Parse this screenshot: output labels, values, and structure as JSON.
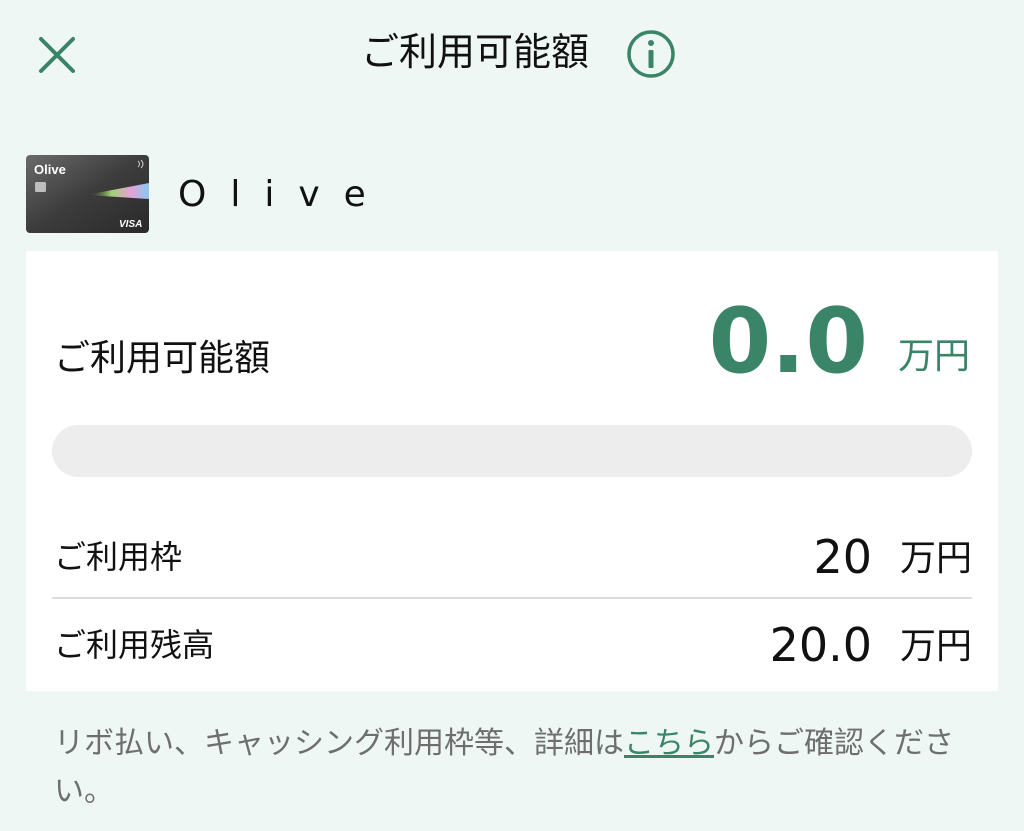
{
  "header": {
    "title": "ご利用可能額",
    "close_icon": "close-icon",
    "info_icon": "info-icon"
  },
  "card": {
    "image_text": "Olive",
    "brand_text": "VISA",
    "name": "Olive"
  },
  "available": {
    "label": "ご利用可能額",
    "value": "0.0",
    "unit": "万円",
    "usage_fraction": 0
  },
  "rows": [
    {
      "label": "ご利用枠",
      "value": "20",
      "unit": "万円"
    },
    {
      "label": "ご利用残高",
      "value": "20.0",
      "unit": "万円"
    }
  ],
  "footnote": {
    "before_link": "リボ払い、キャッシング利用枠等、詳細は",
    "link": "こちら",
    "after_link": "からご確認ください。"
  },
  "colors": {
    "accent": "#3a8468",
    "background": "#eef7f3",
    "panel": "#ffffff",
    "track": "#ededed"
  }
}
